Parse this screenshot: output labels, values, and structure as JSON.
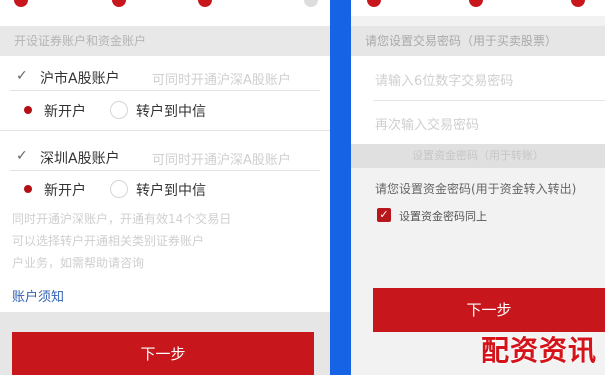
{
  "left": {
    "section_title": "开设证券账户和资金账户",
    "sh": {
      "label": "沪市A股账户",
      "placeholder": "可同时开通沪深A股账户",
      "opt_new": "新开户",
      "opt_transfer": "转户到中信"
    },
    "sz": {
      "label": "深圳A股账户",
      "placeholder": "可同时开通沪深A股账户",
      "opt_new": "新开户",
      "opt_transfer": "转户到中信"
    },
    "note_lines": [
      "同时开通沪深账户，开通有效14个交易日",
      "可以选择转户开通相关类别证券账户",
      "户业务，如需帮助请咨询"
    ],
    "link": "账户须知",
    "next_button": "下一步"
  },
  "right": {
    "header": "请您设置交易密码（用于买卖股票）",
    "trade_pwd_ph": "请输入6位数字交易密码",
    "trade_pwd_confirm_ph": "再次输入交易密码",
    "mid_bar": "设置资金密码（用于转账）",
    "fund_prompt": "请您设置资金密码(用于资金转入转出)",
    "same_checkbox": "设置资金密码同上",
    "next_button": "下一步"
  },
  "watermark": "配资资讯"
}
